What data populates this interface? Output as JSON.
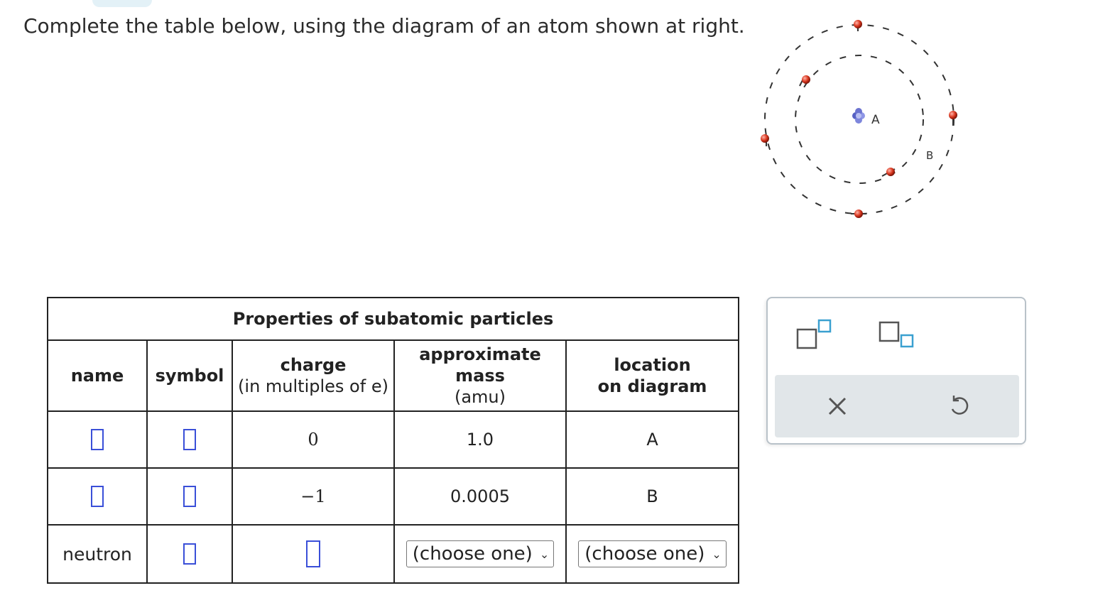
{
  "instructions": "Complete the table below, using the diagram of an atom shown at right.",
  "atom_diagram": {
    "nucleus_label": "A",
    "electron_label": "B"
  },
  "table": {
    "caption": "Properties of subatomic particles",
    "headers": {
      "name": "name",
      "symbol": "symbol",
      "charge_title": "charge",
      "charge_sub": "(in multiples of e)",
      "mass_title_1": "approximate",
      "mass_title_2": "mass",
      "mass_sub": "(amu)",
      "location_1": "location",
      "location_2": "on diagram"
    },
    "rows": [
      {
        "name": "",
        "symbol": "",
        "charge": "0",
        "mass": "1.0",
        "location": "A"
      },
      {
        "name": "",
        "symbol": "",
        "charge": "−1",
        "mass": "0.0005",
        "location": "B"
      },
      {
        "name": "neutron",
        "symbol": "",
        "charge": "",
        "mass_select": "(choose one)",
        "location_select": "(choose one)"
      }
    ]
  },
  "tools": {
    "superscript": "superscript-tool",
    "subscript": "subscript-tool",
    "clear": "✕",
    "undo": "↺"
  },
  "colors": {
    "input_border": "#3a4fd8",
    "electron": "#c0392b",
    "tool_accent": "#3aa0d0"
  }
}
